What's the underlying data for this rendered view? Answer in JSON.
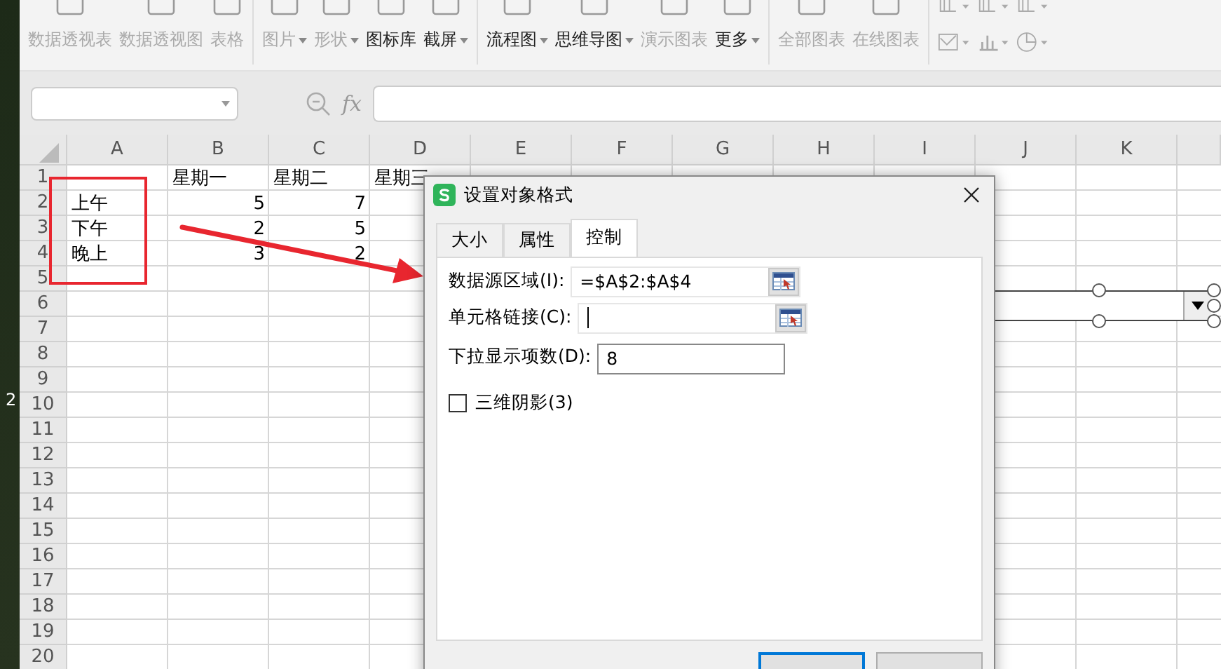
{
  "desktop": {
    "text": "2"
  },
  "toolbar": {
    "groups": [
      [
        {
          "label": "数据透视表",
          "disabled": true,
          "dropdown": false
        },
        {
          "label": "数据透视图",
          "disabled": true,
          "dropdown": false
        },
        {
          "label": "表格",
          "disabled": true,
          "dropdown": false
        }
      ],
      [
        {
          "label": "图片",
          "disabled": true,
          "dropdown": true
        },
        {
          "label": "形状",
          "disabled": true,
          "dropdown": true
        },
        {
          "label": "图标库",
          "disabled": false,
          "dropdown": false
        },
        {
          "label": "截屏",
          "disabled": false,
          "dropdown": true
        }
      ],
      [
        {
          "label": "流程图",
          "disabled": false,
          "dropdown": true
        },
        {
          "label": "思维导图",
          "disabled": false,
          "dropdown": true
        },
        {
          "label": "演示图表",
          "disabled": true,
          "dropdown": false
        },
        {
          "label": "更多",
          "disabled": false,
          "dropdown": true
        }
      ],
      [
        {
          "label": "全部图表",
          "disabled": true,
          "dropdown": false
        },
        {
          "label": "在线图表",
          "disabled": true,
          "dropdown": false
        }
      ]
    ]
  },
  "formula_bar": {
    "fx": "fx"
  },
  "sheet": {
    "columns": [
      "A",
      "B",
      "C",
      "D",
      "E",
      "F",
      "G",
      "H",
      "I",
      "J",
      "K"
    ],
    "rows": [
      {
        "number": "1",
        "cells": [
          null,
          {
            "text": "星期一",
            "kind": "text"
          },
          {
            "text": "星期二",
            "kind": "text"
          },
          {
            "text": "星期三",
            "kind": "text"
          }
        ]
      },
      {
        "number": "2",
        "cells": [
          {
            "text": "上午",
            "kind": "text"
          },
          {
            "text": "5",
            "kind": "number"
          },
          {
            "text": "7",
            "kind": "number"
          }
        ]
      },
      {
        "number": "3",
        "cells": [
          {
            "text": "下午",
            "kind": "text"
          },
          {
            "text": "2",
            "kind": "number"
          },
          {
            "text": "5",
            "kind": "number"
          }
        ]
      },
      {
        "number": "4",
        "cells": [
          {
            "text": "晚上",
            "kind": "text"
          },
          {
            "text": "3",
            "kind": "number"
          },
          {
            "text": "2",
            "kind": "number"
          }
        ]
      },
      {
        "number": "5"
      },
      {
        "number": "6"
      },
      {
        "number": "7"
      },
      {
        "number": "8"
      },
      {
        "number": "9"
      },
      {
        "number": "10"
      },
      {
        "number": "11"
      },
      {
        "number": "12"
      },
      {
        "number": "13"
      },
      {
        "number": "14"
      },
      {
        "number": "15"
      },
      {
        "number": "16"
      },
      {
        "number": "17"
      },
      {
        "number": "18"
      },
      {
        "number": "19"
      },
      {
        "number": "20"
      }
    ]
  },
  "dialog": {
    "title": "设置对象格式",
    "tabs": [
      {
        "label": "大小",
        "selected": false
      },
      {
        "label": "属性",
        "selected": false
      },
      {
        "label": "控制",
        "selected": true
      }
    ],
    "fields": [
      {
        "label": "数据源区域(I):",
        "value": "=$A$2:$A$4",
        "kind": "ref",
        "focused": false
      },
      {
        "label": "单元格链接(C):",
        "kind": "ref",
        "focused": true
      },
      {
        "label": "下拉显示项数(D):",
        "value": "8",
        "kind": "plain",
        "focused": false
      }
    ],
    "checkbox": {
      "label": "三维阴影(3)",
      "checked": false
    },
    "buttons": [
      {
        "default": true
      },
      {
        "default": false
      }
    ]
  }
}
